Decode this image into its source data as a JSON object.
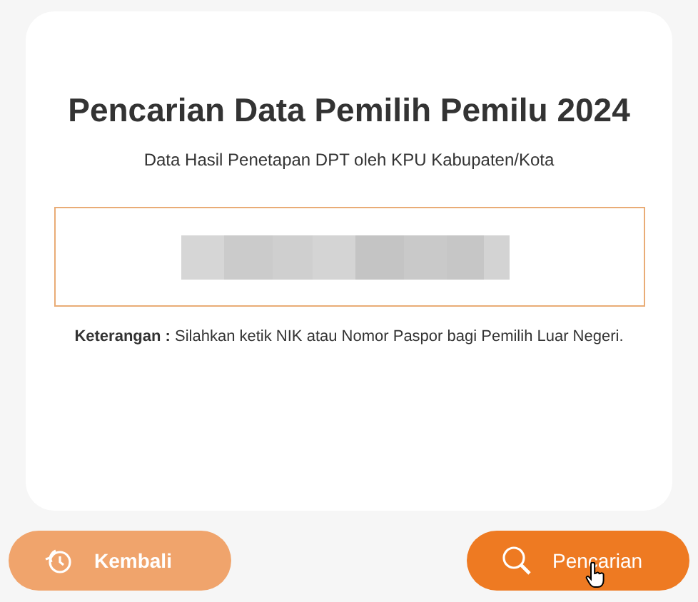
{
  "title": "Pencarian Data Pemilih Pemilu 2024",
  "subtitle": "Data Hasil Penetapan DPT oleh KPU Kabupaten/Kota",
  "search_field": {
    "value_redacted": true
  },
  "note": {
    "label": "Keterangan :",
    "text": "Silahkan ketik NIK atau Nomor Paspor bagi Pemilih Luar Negeri."
  },
  "buttons": [
    {
      "label": "Kembali",
      "kind": "back"
    },
    {
      "label": "Pencarian",
      "kind": "search"
    }
  ]
}
